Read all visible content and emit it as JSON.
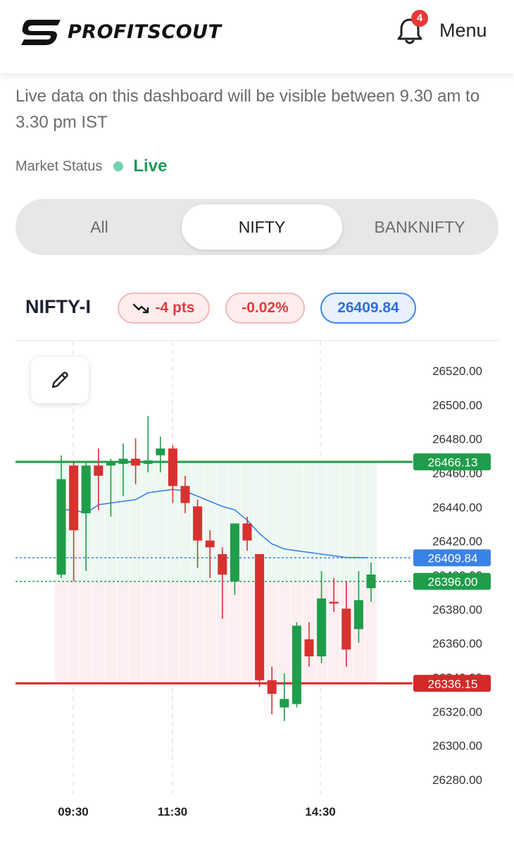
{
  "header": {
    "brand": "PROFITSCOUT",
    "notification_count": "4",
    "menu_label": "Menu"
  },
  "notice": "Live data on this dashboard will be visible between 9.30 am to 3.30 pm IST",
  "market_status": {
    "label": "Market Status",
    "value": "Live",
    "color": "#1f9a5b"
  },
  "tabs": [
    {
      "label": "All",
      "active": false
    },
    {
      "label": "NIFTY",
      "active": true
    },
    {
      "label": "BANKNIFTY",
      "active": false
    }
  ],
  "instrument": {
    "symbol": "NIFTY-I",
    "change_pts": "-4 pts",
    "change_pct": "-0.02%",
    "ltp": "26409.84",
    "trend_icon": "trending-down-icon"
  },
  "chart_data": {
    "type": "candlestick",
    "y_ticks": [
      "26520.00",
      "26500.00",
      "26480.00",
      "26460.00",
      "26440.00",
      "26420.00",
      "26400.00",
      "26380.00",
      "26360.00",
      "26340.00",
      "26320.00",
      "26300.00",
      "26280.00"
    ],
    "x_ticks": [
      "09:30",
      "11:30",
      "14:30"
    ],
    "ylim": [
      26272,
      26522
    ],
    "levels": [
      {
        "value": 26466.13,
        "label": "26466.13",
        "color": "#1f9d4a",
        "style": "solid"
      },
      {
        "value": 26409.84,
        "label": "26409.84",
        "color": "#3b82e6",
        "style": "dotted"
      },
      {
        "value": 26396.0,
        "label": "26396.00",
        "color": "#1f9d4a",
        "style": "dotted"
      },
      {
        "value": 26336.15,
        "label": "26336.15",
        "color": "#d62828",
        "style": "solid"
      }
    ],
    "up_color": "#1f9d4a",
    "down_color": "#d93030",
    "candles": [
      {
        "o": 26400,
        "h": 26470,
        "l": 26398,
        "c": 26456
      },
      {
        "o": 26464,
        "h": 26466,
        "l": 26396,
        "c": 26426
      },
      {
        "o": 26436,
        "h": 26466,
        "l": 26402,
        "c": 26464
      },
      {
        "o": 26464,
        "h": 26474,
        "l": 26438,
        "c": 26458
      },
      {
        "o": 26464,
        "h": 26468,
        "l": 26434,
        "c": 26466
      },
      {
        "o": 26465,
        "h": 26477,
        "l": 26446,
        "c": 26468
      },
      {
        "o": 26468,
        "h": 26480,
        "l": 26453,
        "c": 26464
      },
      {
        "o": 26465,
        "h": 26493,
        "l": 26460,
        "c": 26467
      },
      {
        "o": 26470,
        "h": 26481,
        "l": 26460,
        "c": 26474
      },
      {
        "o": 26474,
        "h": 26476,
        "l": 26442,
        "c": 26452
      },
      {
        "o": 26452,
        "h": 26458,
        "l": 26436,
        "c": 26442
      },
      {
        "o": 26440,
        "h": 26444,
        "l": 26404,
        "c": 26420
      },
      {
        "o": 26420,
        "h": 26426,
        "l": 26398,
        "c": 26416
      },
      {
        "o": 26412,
        "h": 26416,
        "l": 26374,
        "c": 26400
      },
      {
        "o": 26396,
        "h": 26430,
        "l": 26388,
        "c": 26430
      },
      {
        "o": 26430,
        "h": 26434,
        "l": 26414,
        "c": 26420
      },
      {
        "o": 26412,
        "h": 26412,
        "l": 26334,
        "c": 26338
      },
      {
        "o": 26338,
        "h": 26346,
        "l": 26318,
        "c": 26330
      },
      {
        "o": 26322,
        "h": 26342,
        "l": 26314,
        "c": 26327
      },
      {
        "o": 26324,
        "h": 26372,
        "l": 26322,
        "c": 26370
      },
      {
        "o": 26362,
        "h": 26372,
        "l": 26346,
        "c": 26352
      },
      {
        "o": 26352,
        "h": 26402,
        "l": 26348,
        "c": 26386
      },
      {
        "o": 26384,
        "h": 26398,
        "l": 26378,
        "c": 26383
      },
      {
        "o": 26380,
        "h": 26396,
        "l": 26346,
        "c": 26356
      },
      {
        "o": 26368,
        "h": 26402,
        "l": 26360,
        "c": 26385
      },
      {
        "o": 26392,
        "h": 26407,
        "l": 26384,
        "c": 26400
      }
    ],
    "average_line": [
      26438,
      26438,
      26436,
      26441,
      26442,
      26443,
      26444,
      26448,
      26449,
      26450,
      26449,
      26446,
      26443,
      26440,
      26438,
      26432,
      26424,
      26418,
      26415,
      26414,
      26413,
      26412,
      26411,
      26410,
      26410,
      26409.84
    ]
  }
}
